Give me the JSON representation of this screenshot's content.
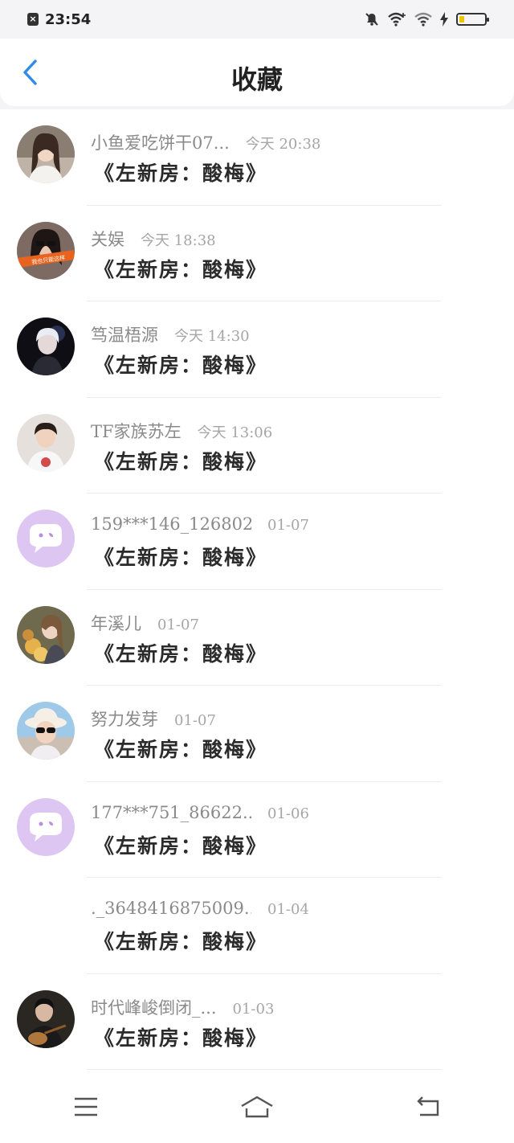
{
  "status_bar": {
    "time": "23:54",
    "icons": [
      "notification-close-icon",
      "mute-icon",
      "wifi-plus-icon",
      "wifi-icon",
      "charging-icon",
      "battery-icon"
    ]
  },
  "header": {
    "title": "收藏",
    "back_icon": "chevron-left-icon",
    "accent_color": "#2f8be8"
  },
  "items": [
    {
      "name": "小鱼爱吃饼干07...",
      "time": "今天 20:38",
      "title": "《左新房：酸梅》",
      "avatar": "photo-girl-white-blouse"
    },
    {
      "name": "关娱",
      "time": "今天 18:38",
      "title": "《左新房：酸梅》",
      "avatar": "photo-sunglasses-banner"
    },
    {
      "name": "笃温梧源",
      "time": "今天 14:30",
      "title": "《左新房：酸梅》",
      "avatar": "photo-silver-hair-singer"
    },
    {
      "name": "TF家族苏左",
      "time": "今天 13:06",
      "title": "《左新房：酸梅》",
      "avatar": "photo-boy-white-tee"
    },
    {
      "name": "159***146_126802...",
      "time": "01-07",
      "title": "《左新房：酸梅》",
      "avatar": "default-chat-bubble-avatar"
    },
    {
      "name": "年溪儿",
      "time": "01-07",
      "title": "《左新房：酸梅》",
      "avatar": "photo-flowers-portrait"
    },
    {
      "name": "努力发芽",
      "time": "01-07",
      "title": "《左新房：酸梅》",
      "avatar": "photo-hat-sunglasses"
    },
    {
      "name": "177***751_86622...",
      "time": "01-06",
      "title": "《左新房：酸梅》",
      "avatar": "default-chat-bubble-avatar"
    },
    {
      "name": "._3648416875009...",
      "time": "01-04",
      "title": "《左新房：酸梅》",
      "avatar": "none"
    },
    {
      "name": "时代峰峻倒闭_...",
      "time": "01-03",
      "title": "《左新房：酸梅》",
      "avatar": "photo-guitar-boy"
    }
  ],
  "nav_bar": {
    "icons": [
      "menu-icon",
      "home-icon",
      "back-return-icon"
    ]
  }
}
